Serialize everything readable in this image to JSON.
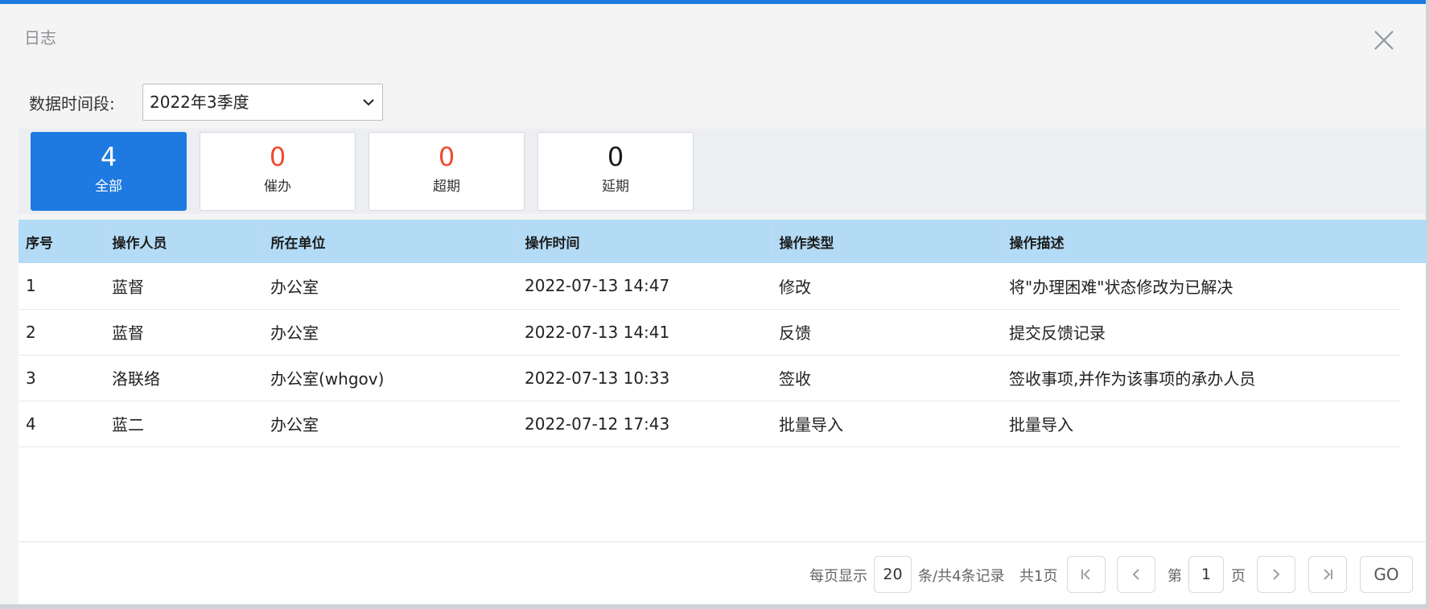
{
  "dialog": {
    "title": "日志"
  },
  "filter": {
    "label": "数据时间段:",
    "selected": "2022年3季度"
  },
  "stats": [
    {
      "count": "4",
      "label": "全部",
      "active": true
    },
    {
      "count": "0",
      "label": "催办",
      "active": false
    },
    {
      "count": "0",
      "label": "超期",
      "active": false
    },
    {
      "count": "0",
      "label": "延期",
      "active": false
    }
  ],
  "table": {
    "headers": [
      "序号",
      "操作人员",
      "所在单位",
      "操作时间",
      "操作类型",
      "操作描述"
    ],
    "rows": [
      [
        "1",
        "蓝督",
        "办公室",
        "2022-07-13 14:47",
        "修改",
        "将\"办理困难\"状态修改为已解决"
      ],
      [
        "2",
        "蓝督",
        "办公室",
        "2022-07-13 14:41",
        "反馈",
        "提交反馈记录"
      ],
      [
        "3",
        "洛联络",
        "办公室(whgov)",
        "2022-07-13 10:33",
        "签收",
        "签收事项,并作为该事项的承办人员"
      ],
      [
        "4",
        "蓝二",
        "办公室",
        "2022-07-12 17:43",
        "批量导入",
        "批量导入"
      ]
    ]
  },
  "pagination": {
    "per_page_label": "每页显示",
    "per_page": "20",
    "records_text": "条/共4条记录",
    "pages_text": "共1页",
    "page_prefix": "第",
    "current_page": "1",
    "page_suffix": "页",
    "go_label": "GO"
  },
  "colors": {
    "accent": "#1e7ae0",
    "header_bg": "#b3dbf6",
    "warning": "#f04a32"
  }
}
